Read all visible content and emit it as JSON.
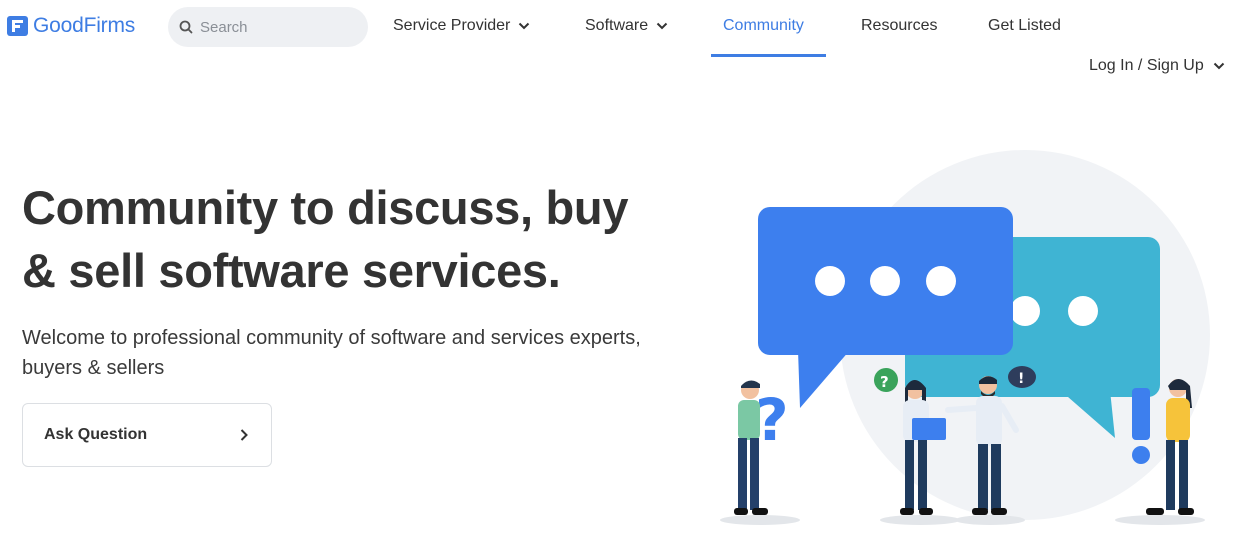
{
  "header": {
    "logo_text": "GoodFirms",
    "search_placeholder": "Search",
    "nav": {
      "service_provider": "Service Provider",
      "software": "Software",
      "community": "Community",
      "resources": "Resources",
      "get_listed": "Get Listed"
    },
    "login": "Log In / Sign Up"
  },
  "hero": {
    "title_line1": "Community to discuss, buy",
    "title_line2": "& sell software services.",
    "subtitle_line1": "Welcome to professional community of software and services experts,",
    "subtitle_line2": "buyers & sellers",
    "ask_button": "Ask Question"
  },
  "colors": {
    "brand_blue": "#3e7de3",
    "bubble_blue": "#3d7fee",
    "bubble_teal": "#3fb4d3",
    "text_dark": "#333333"
  },
  "icons": {
    "search": "search-icon",
    "chevron_down": "chevron-down-icon",
    "chevron_right": "chevron-right-icon"
  }
}
